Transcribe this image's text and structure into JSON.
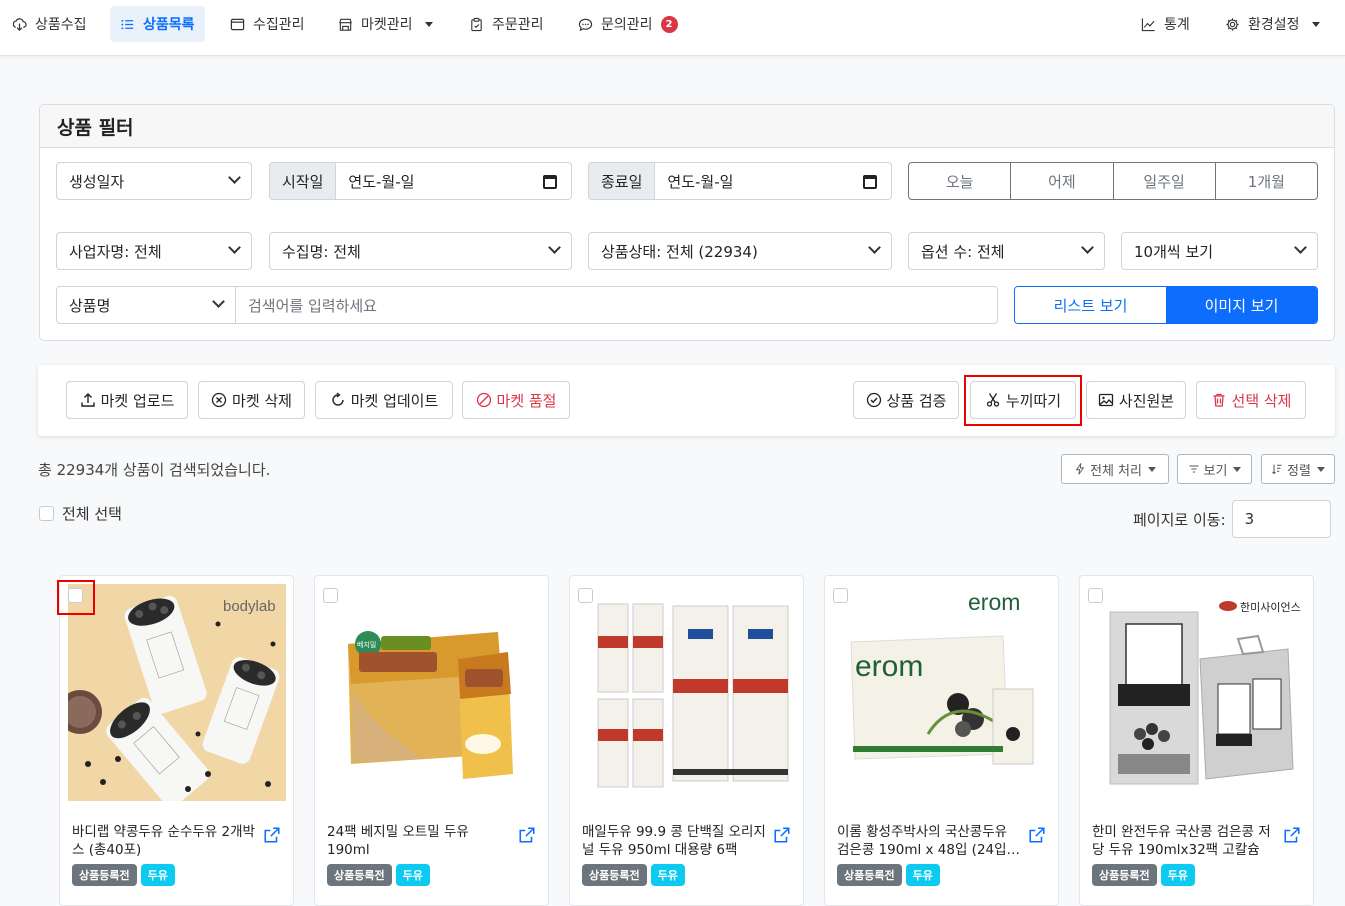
{
  "nav": {
    "items": [
      {
        "label": "상품수집",
        "icon": "cloud-download-icon"
      },
      {
        "label": "상품목록",
        "icon": "list-icon",
        "active": true
      },
      {
        "label": "수집관리",
        "icon": "window-icon"
      },
      {
        "label": "마켓관리",
        "icon": "shop-icon",
        "dropdown": true
      },
      {
        "label": "주문관리",
        "icon": "clipboard-icon"
      },
      {
        "label": "문의관리",
        "icon": "chat-icon",
        "badge": "2"
      }
    ],
    "stats_label": "통계",
    "settings_label": "환경설정"
  },
  "filter": {
    "title": "상품 필터",
    "date_type": "생성일자",
    "start_label": "시작일",
    "start_value": "연도-월-일",
    "end_label": "종료일",
    "end_value": "연도-월-일",
    "quick_ranges": [
      "오늘",
      "어제",
      "일주일",
      "1개월"
    ],
    "business": "사업자명: 전체",
    "collection": "수집명: 전체",
    "status": "상품상태: 전체 (22934)",
    "options": "옵션 수: 전체",
    "per_page": "10개씩 보기",
    "search_field": "상품명",
    "search_placeholder": "검색어를 입력하세요",
    "view_list": "리스트 보기",
    "view_image": "이미지 보기"
  },
  "toolbar": {
    "market_upload": "마켓 업로드",
    "market_delete": "마켓 삭제",
    "market_update": "마켓 업데이트",
    "market_soldout": "마켓 품절",
    "verify": "상품 검증",
    "remove_bg": "누끼따기",
    "original_photo": "사진원본",
    "delete_selected": "선택 삭제"
  },
  "results": {
    "count_text": "총 22934개 상품이 검색되었습니다.",
    "bulk_label": "전체 처리",
    "view_label": "보기",
    "sort_label": "정렬",
    "select_all": "전체 선택",
    "page_move_label": "페이지로 이동:",
    "page_value": "3"
  },
  "products": [
    {
      "title": "바디랩 약콩두유 순수두유 2개박스 (총40포)",
      "status": "상품등록전",
      "category": "두유",
      "brand": "bodylab"
    },
    {
      "title": "24팩 베지밀 오트밀 두유 190ml",
      "status": "상품등록전",
      "category": "두유",
      "brand": "베지밀"
    },
    {
      "title": "매일두유 99.9 콩 단백질 오리지널 두유 950ml 대용량 6팩",
      "status": "상품등록전",
      "category": "두유",
      "brand": "매일"
    },
    {
      "title": "이롬 황성주박사의 국산콩두유 검은콩 190ml x 48입 (24입…",
      "status": "상품등록전",
      "category": "두유",
      "brand": "erom"
    },
    {
      "title": "한미 완전두유 국산콩 검은콩 저당 두유 190mlx32팩 고칼슘 …",
      "status": "상품등록전",
      "category": "두유",
      "brand": "한미사이언스"
    }
  ],
  "colors": {
    "primary": "#0d6efd",
    "danger": "#dc3545",
    "highlight": "#ee0000",
    "info": "#0dcaf0"
  }
}
